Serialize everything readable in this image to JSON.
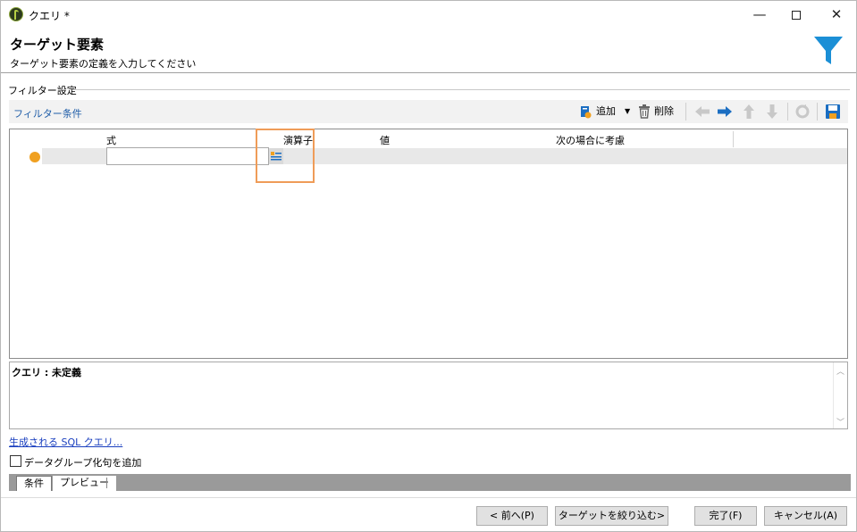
{
  "window": {
    "title": "クエリ *",
    "minimize_glyph": "—",
    "close_glyph": "✕"
  },
  "header": {
    "title": "ターゲット要素",
    "subtitle": "ターゲット要素の定義を入力してください",
    "icon": "funnel-icon",
    "icon_color": "#1b8fd6"
  },
  "section": {
    "label": "フィルター設定"
  },
  "toolbar": {
    "title": "フィルター条件",
    "add_label": "追加",
    "delete_label": "削除",
    "icons": [
      "add-condition-icon",
      "dropdown-arrow-icon",
      "trash-icon",
      "arrow-left-icon",
      "arrow-right-icon",
      "arrow-up-icon",
      "arrow-down-icon",
      "refresh-icon",
      "save-icon"
    ],
    "accent_color": "#1b6ec2"
  },
  "grid": {
    "columns": [
      "式",
      "演算子",
      "値",
      "次の場合に考慮"
    ],
    "rows": [
      {
        "expression": "",
        "operator": "",
        "value": "",
        "consider_if": ""
      }
    ],
    "bullet_color": "#f0a020",
    "highlight_color": "#ef9c58"
  },
  "query": {
    "text": "クエリ : 未定義"
  },
  "sql_link": "生成される SQL クエリ...",
  "group_checkbox": {
    "label": "データグループ化句を追加",
    "checked": false
  },
  "tabs": [
    {
      "label": "条件",
      "active": true
    },
    {
      "label": "プレビュー",
      "active": false
    }
  ],
  "buttons": {
    "prev": "< 前へ(P)",
    "narrow": "ターゲットを絞り込む>",
    "finish": "完了(F)",
    "cancel": "キャンセル(A)"
  }
}
